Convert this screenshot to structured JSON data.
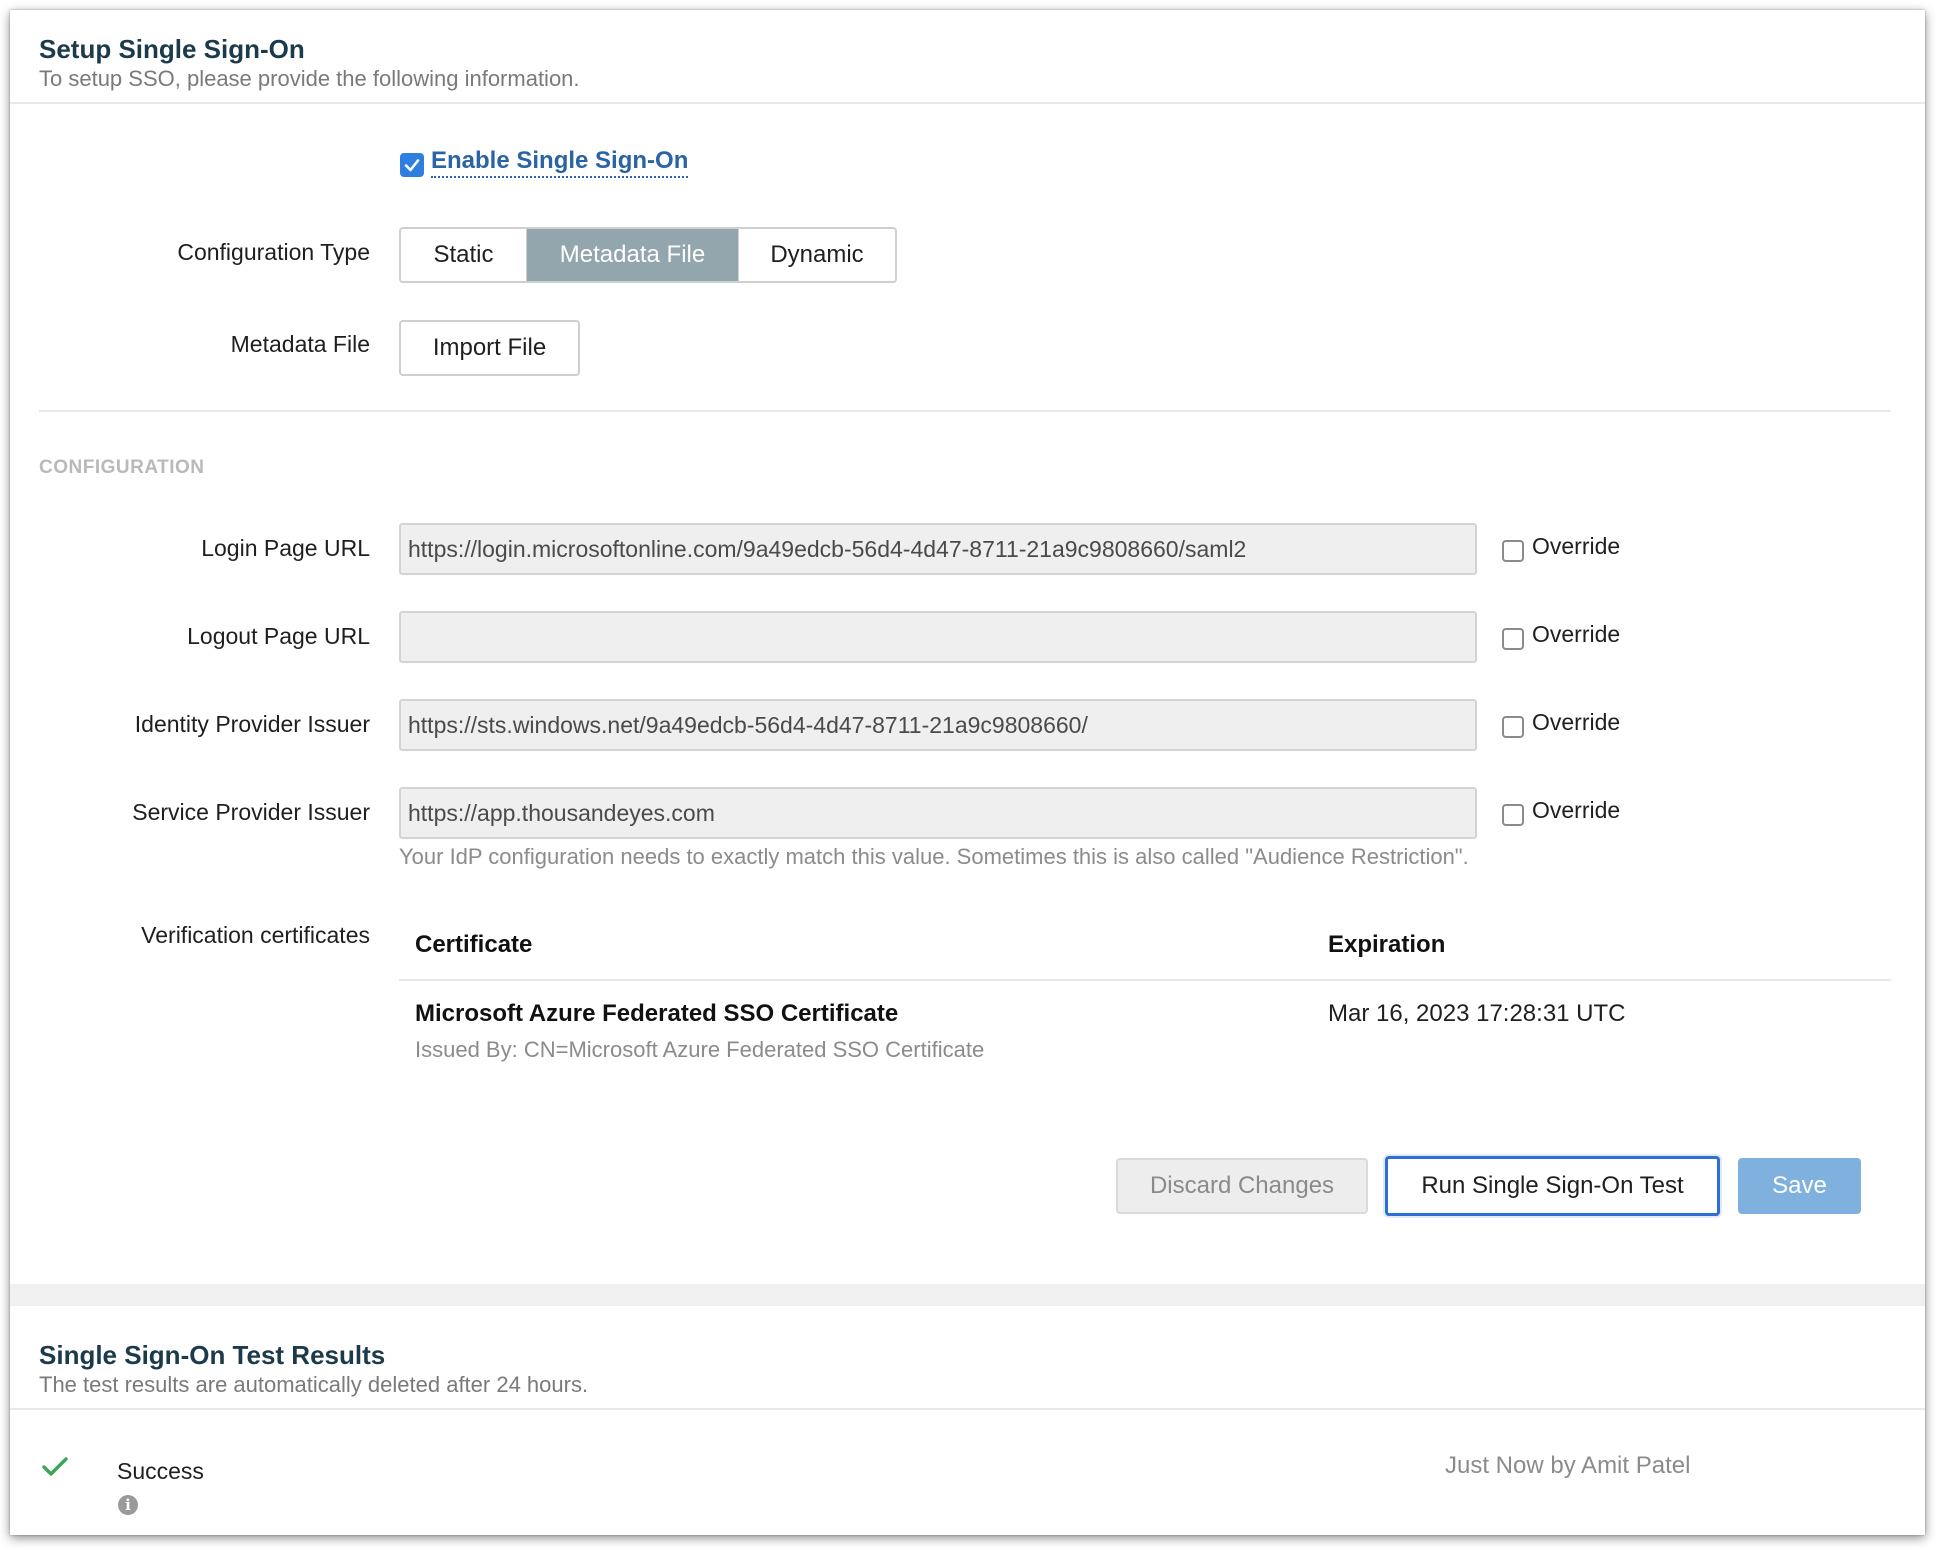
{
  "setup": {
    "title": "Setup Single Sign-On",
    "subtitle": "To setup SSO, please provide the following information."
  },
  "enable_sso": {
    "label": "Enable Single Sign-On",
    "checked": true
  },
  "config_type": {
    "label": "Configuration Type",
    "options": [
      "Static",
      "Metadata File",
      "Dynamic"
    ],
    "selected": "Metadata File"
  },
  "metadata_file": {
    "label": "Metadata File",
    "button": "Import File"
  },
  "configuration": {
    "caption": "CONFIGURATION",
    "override_label": "Override",
    "fields": [
      {
        "label": "Login Page URL",
        "value": "https://login.microsoftonline.com/9a49edcb-56d4-4d47-8711-21a9c9808660/saml2",
        "override": false
      },
      {
        "label": "Logout Page URL",
        "value": "",
        "override": false
      },
      {
        "label": "Identity Provider Issuer",
        "value": "https://sts.windows.net/9a49edcb-56d4-4d47-8711-21a9c9808660/",
        "override": false
      },
      {
        "label": "Service Provider Issuer",
        "value": "https://app.thousandeyes.com",
        "override": false
      }
    ],
    "sp_hint": "Your IdP configuration needs to exactly match this value. Sometimes this is also called \"Audience Restriction\"."
  },
  "certificates": {
    "label": "Verification certificates",
    "headers": {
      "certificate": "Certificate",
      "expiration": "Expiration"
    },
    "rows": [
      {
        "name": "Microsoft Azure Federated SSO Certificate",
        "issuer": "Issued By: CN=Microsoft Azure Federated SSO Certificate",
        "expiration": "Mar 16, 2023 17:28:31 UTC"
      }
    ]
  },
  "actions": {
    "discard": "Discard Changes",
    "test": "Run Single Sign-On Test",
    "save": "Save"
  },
  "test_results": {
    "title": "Single Sign-On Test Results",
    "subtitle": "The test results are automatically deleted after 24 hours.",
    "result": {
      "status": "Success",
      "byline": "Just Now by Amit Patel"
    }
  },
  "colors": {
    "accent": "#2f7fe0",
    "link": "#2a63a6",
    "segment_selected": "#93a6ad",
    "save_button": "#7fb0de",
    "success": "#3aa655"
  },
  "icons": [
    "checkbox-checked-icon",
    "checkmark-icon",
    "info-icon"
  ]
}
